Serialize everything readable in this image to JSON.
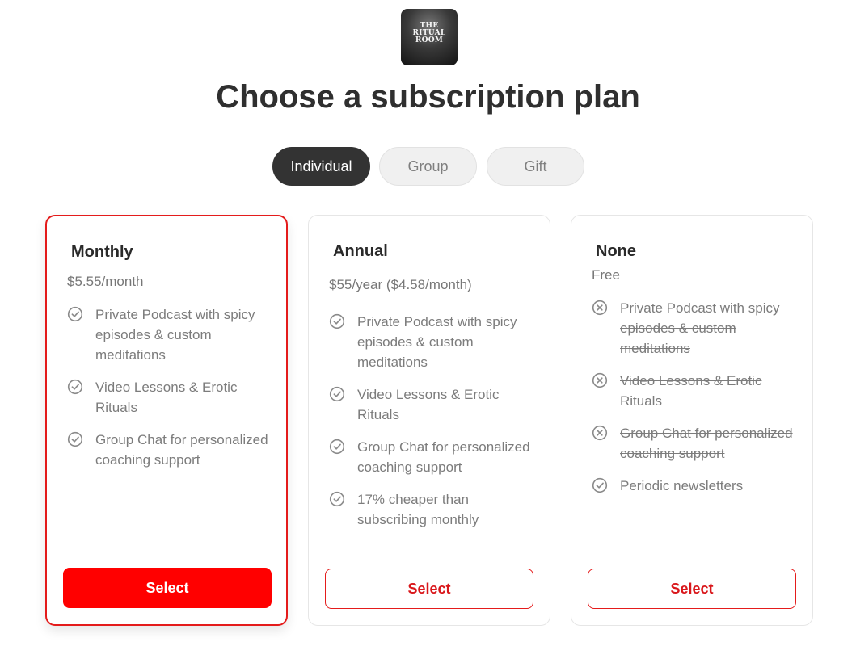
{
  "logo": {
    "lines": [
      "THE",
      "RITUAL",
      "ROOM"
    ]
  },
  "title": "Choose a subscription plan",
  "tabs": [
    {
      "label": "Individual"
    },
    {
      "label": "Group"
    },
    {
      "label": "Gift"
    }
  ],
  "plans": [
    {
      "name": "Monthly",
      "price": "$5.55/month",
      "features": [
        {
          "text": "Private Podcast with spicy episodes & custom meditations",
          "icon": "check-circle-icon"
        },
        {
          "text": "Video Lessons & Erotic Rituals",
          "icon": "check-circle-icon"
        },
        {
          "text": "Group Chat for personalized coaching support",
          "icon": "check-circle-icon"
        }
      ],
      "button": "Select"
    },
    {
      "name": "Annual",
      "price": "$55/year ($4.58/month)",
      "features": [
        {
          "text": "Private Podcast with spicy episodes & custom meditations",
          "icon": "check-circle-icon"
        },
        {
          "text": "Video Lessons & Erotic Rituals",
          "icon": "check-circle-icon"
        },
        {
          "text": "Group Chat for personalized coaching support",
          "icon": "check-circle-icon"
        },
        {
          "text": "17% cheaper than subscribing monthly",
          "icon": "check-circle-icon"
        }
      ],
      "button": "Select"
    },
    {
      "name": "None",
      "price": "Free",
      "features": [
        {
          "text": "Private Podcast with spicy episodes & custom meditations",
          "icon": "x-circle-icon"
        },
        {
          "text": "Video Lessons & Erotic Rituals",
          "icon": "x-circle-icon"
        },
        {
          "text": "Group Chat for personalized coaching support",
          "icon": "x-circle-icon"
        },
        {
          "text": "Periodic newsletters",
          "icon": "check-circle-icon"
        }
      ],
      "button": "Select"
    }
  ],
  "colors": {
    "accent": "#ff0000",
    "dark": "#333333"
  }
}
